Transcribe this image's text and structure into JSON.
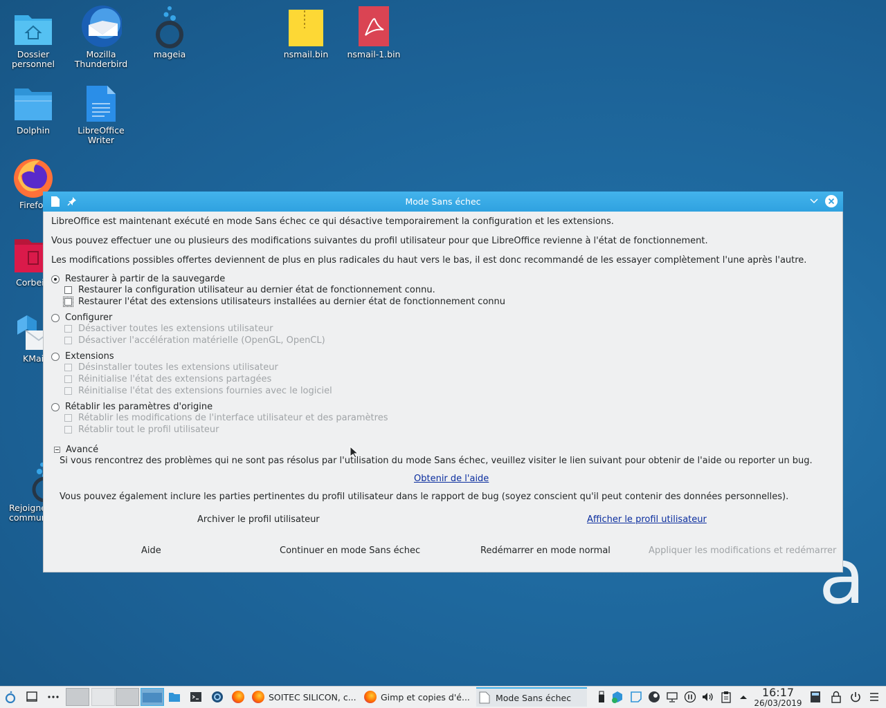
{
  "colors": {
    "titlebar": "#3daee9",
    "link": "#0a2d9e",
    "desktop": "#1f6aa0"
  },
  "desktop": {
    "icons": [
      {
        "label": "Dossier personnel",
        "icon": "home-folder-icon"
      },
      {
        "label": "Mozilla Thunderbird",
        "icon": "thunderbird-icon"
      },
      {
        "label": "mageia",
        "icon": "mageia-icon"
      },
      {
        "label": "nsmail.bin",
        "icon": "archive-file-icon"
      },
      {
        "label": "nsmail-1.bin",
        "icon": "pdf-file-icon"
      },
      {
        "label": "Dolphin",
        "icon": "folder-icon"
      },
      {
        "label": "LibreOffice Writer",
        "icon": "writer-document-icon"
      },
      {
        "label": "Firefo",
        "icon": "firefox-icon"
      },
      {
        "label": "Corbei",
        "icon": "trash-icon"
      },
      {
        "label": "KMai",
        "icon": "kmail-icon"
      },
      {
        "label": "Rejoigne commun",
        "icon": "mageia-community-icon"
      }
    ]
  },
  "window": {
    "title": "Mode Sans échec"
  },
  "dialog": {
    "intro1": "LibreOffice est maintenant exécuté en mode Sans échec ce qui désactive temporairement la configuration et les extensions.",
    "intro2": "Vous pouvez effectuer une ou plusieurs des modifications suivantes du profil utilisateur pour que LibreOffice revienne à l'état de fonctionnement.",
    "intro3": "Les modifications possibles offertes deviennent de plus en plus radicales du haut vers le bas, il est donc recommandé de les essayer complètement l'une après l'autre.",
    "options": [
      {
        "label": "Restaurer à partir de la sauvegarde",
        "checks": [
          "Restaurer la configuration utilisateur au dernier état de fonctionnement connu.",
          "Restaurer l'état des extensions utilisateurs installées au dernier état de fonctionnement connu"
        ]
      },
      {
        "label": "Configurer",
        "checks": [
          "Désactiver toutes les extensions utilisateur",
          "Désactiver l'accélération matérielle (OpenGL, OpenCL)"
        ]
      },
      {
        "label": "Extensions",
        "checks": [
          "Désinstaller toutes les extensions utilisateur",
          "Réinitialise l'état des extensions partagées",
          "Réinitialise l'état des extensions fournies avec le logiciel"
        ]
      },
      {
        "label": "Rétablir les paramètres d'origine",
        "checks": [
          "Rétablir les modifications de l'interface utilisateur et des paramètres",
          "Rétablir tout le profil utilisateur"
        ]
      }
    ],
    "advanced_label": "Avancé",
    "advanced_text": "Si vous rencontrez des problèmes qui ne sont pas résolus par l'utilisation du mode Sans échec, veuillez visiter le lien suivant pour obtenir de l'aide ou reporter un bug.",
    "help_link": "Obtenir de l'aide",
    "include_text": "Vous pouvez également inclure les parties pertinentes du profil utilisateur dans le rapport de bug (soyez conscient qu'il peut contenir des données personnelles).",
    "archive_label": "Archiver le profil utilisateur",
    "show_profile_link": "Afficher le profil utilisateur",
    "buttons": {
      "help": "Aide",
      "continue": "Continuer en mode Sans échec",
      "restart": "Redémarrer en mode normal",
      "apply": "Appliquer les modifications et redémarrer"
    }
  },
  "taskbar": {
    "tasks": [
      {
        "label": "SOITEC SILICON, c..."
      },
      {
        "label": "Gimp et copies d'é..."
      },
      {
        "label": "Mode Sans échec"
      }
    ],
    "time": "16:17",
    "date": "26/03/2019"
  }
}
